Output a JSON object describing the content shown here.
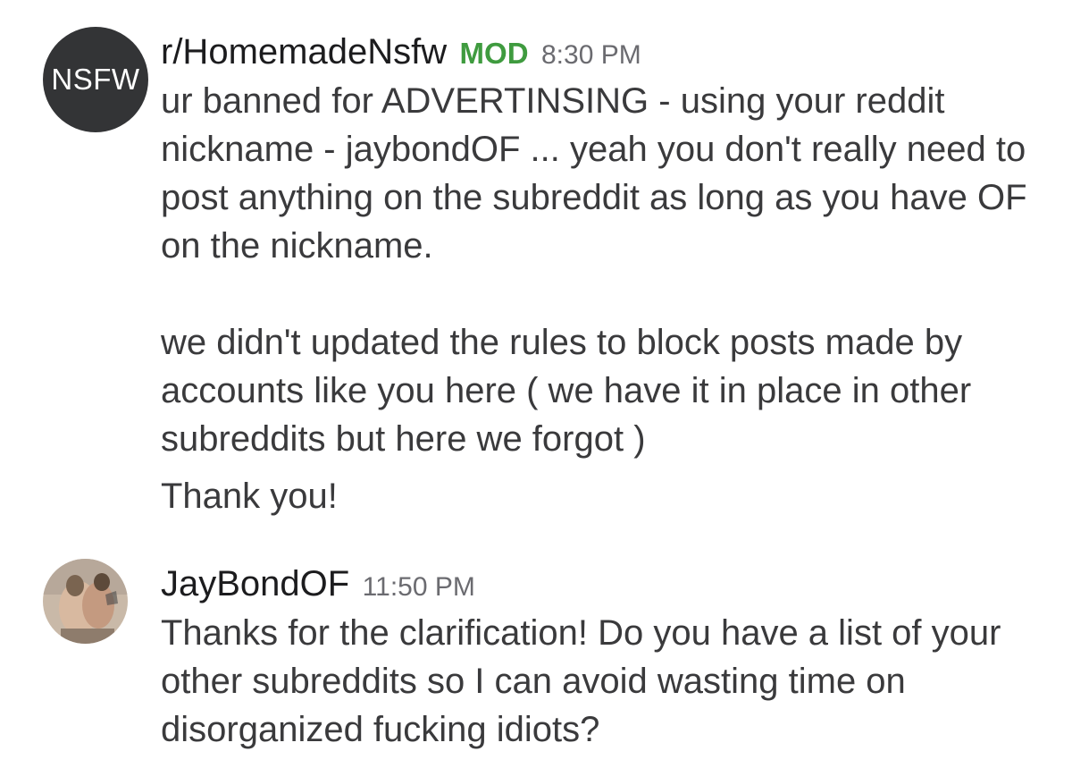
{
  "messages": [
    {
      "avatar_text": "NSFW",
      "author": "r/HomemadeNsfw",
      "badge": "MOD",
      "time": "8:30 PM",
      "paragraphs": [
        "ur banned for ADVERTINSING - using your reddit nickname - jaybondOF ... yeah you don't really need to post anything on the subreddit as long as you have OF on the nickname.",
        "we didn't updated the rules to block posts made by accounts like you here ( we have it in place in other subreddits but here we forgot )",
        "Thank you!"
      ]
    },
    {
      "author": "JayBondOF",
      "time": "11:50 PM",
      "paragraphs": [
        "Thanks for the clarification! Do you have a list of your other subreddits so I can avoid wasting time on disorganized fucking idiots?"
      ]
    }
  ],
  "colors": {
    "mod_badge": "#3f9b3f",
    "text": "#3a3a3c",
    "timestamp": "#6b6b70",
    "nsfw_avatar_bg": "#333436"
  }
}
